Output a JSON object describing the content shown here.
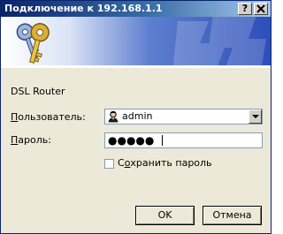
{
  "window": {
    "title": "Подключение к 192.168.1.1",
    "help_button": "?",
    "close_button": "X"
  },
  "realm": "DSL Router",
  "username": {
    "label_accel": "П",
    "label_rest": "ользователь:",
    "value": "admin"
  },
  "password": {
    "label_accel": "П",
    "label_rest": "ароль:",
    "masked_value": "●●●●●"
  },
  "remember": {
    "label_pre": "С",
    "label_accel": "о",
    "label_rest": "хранить пароль",
    "checked": false
  },
  "buttons": {
    "ok": "OK",
    "cancel": "Отмена"
  },
  "colors": {
    "title_bar_start": "#0a246a",
    "title_bar_end": "#a6caf0",
    "dialog_face": "#ece9d8",
    "banner_blue": "#2c4eb8",
    "key_gold": "#d9b13a"
  },
  "icons": {
    "banner": "keys-icon",
    "user_field": "user-icon"
  }
}
